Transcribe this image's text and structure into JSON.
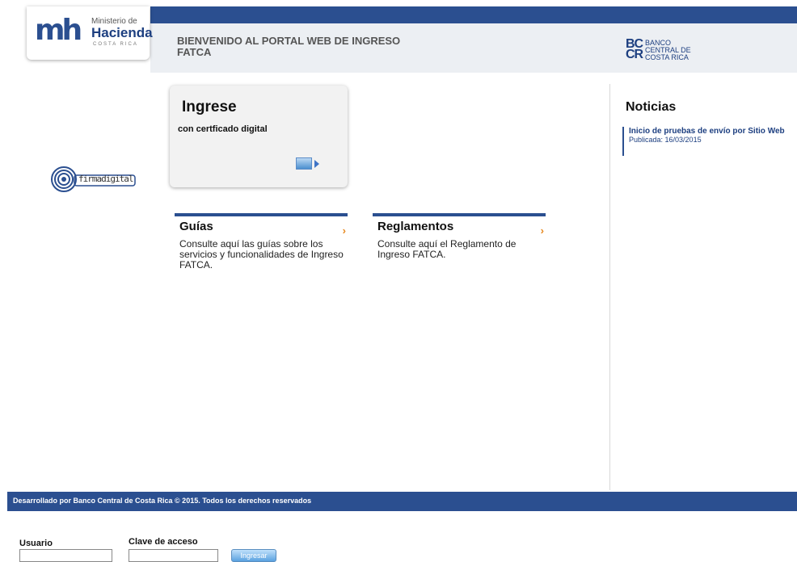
{
  "header": {
    "brand_logo": {
      "letters": "mh",
      "line1": "Ministerio de",
      "line2": "Hacienda",
      "line3": "COSTA RICA"
    },
    "welcome_line1": "BIENVENIDO AL PORTAL WEB DE INGRESO",
    "welcome_line2": "FATCA",
    "bccr_logo": {
      "mark": "BC\nCR",
      "line1": "BANCO",
      "line2": "CENTRAL DE",
      "line3": "COSTA RICA"
    }
  },
  "firma_logo_text": "firmadigital",
  "login_card": {
    "title": "Ingrese",
    "subtitle": "con certficado digital",
    "icon": "certificate-card-arrow-icon"
  },
  "sections": [
    {
      "title": "Guías",
      "text": "Consulte aquí las guías sobre los servicios y funcionalidades de Ingreso FATCA."
    },
    {
      "title": "Reglamentos",
      "text": "Consulte aquí el Reglamento de Ingreso FATCA."
    }
  ],
  "news": {
    "title": "Noticias",
    "items": [
      {
        "title": "Inicio de pruebas de envío por Sitio Web",
        "date": "Publicada: 16/03/2015"
      }
    ]
  },
  "footer": {
    "text": "Desarrollado por Banco Central de Costa Rica © 2015. Todos los derechos reservados"
  },
  "login": {
    "user_label": "Usuario",
    "user_value": "",
    "pass_label": "Clave de acceso",
    "pass_value": "",
    "button_label": "Ingresar"
  },
  "colors": {
    "primary": "#2b4f90",
    "accent": "#e7891f"
  }
}
